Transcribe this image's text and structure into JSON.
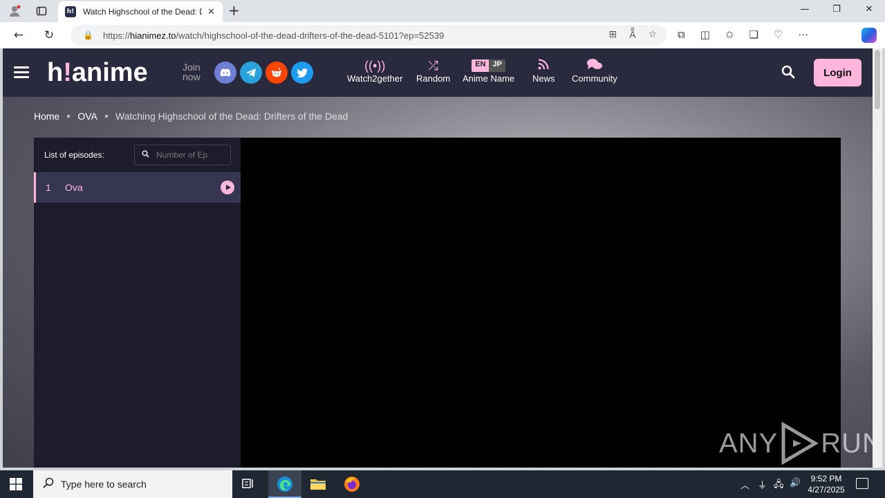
{
  "browser": {
    "tab_title": "Watch Highschool of the Dead: Drifters of the Dead",
    "tab_favicon_text": "h!",
    "url_prefix": "https://",
    "url_domain": "hianimez.to",
    "url_path": "/watch/highschool-of-the-dead-drifters-of-the-dead-5101?ep=52539"
  },
  "site": {
    "logo_main_1": "h",
    "logo_bang": "!",
    "logo_main_2": "anime",
    "join_line1": "Join",
    "join_line2": "now",
    "menu": {
      "watch2gether": "Watch2gether",
      "random": "Random",
      "anime_name": "Anime Name",
      "lang_en": "EN",
      "lang_jp": "JP",
      "news": "News",
      "community": "Community"
    },
    "login_label": "Login",
    "accent_color": "#ffb6dd"
  },
  "breadcrumb": {
    "home": "Home",
    "category": "OVA",
    "current": "Watching Highschool of the Dead: Drifters of the Dead"
  },
  "episodes": {
    "header_label": "List of episodes:",
    "search_placeholder": "Number of Ep",
    "items": [
      {
        "number": "1",
        "title": "Ova"
      }
    ]
  },
  "watermark": {
    "left": "ANY",
    "right": "RUN"
  },
  "taskbar": {
    "search_placeholder": "Type here to search",
    "time": "9:52 PM",
    "date": "4/27/2025"
  }
}
